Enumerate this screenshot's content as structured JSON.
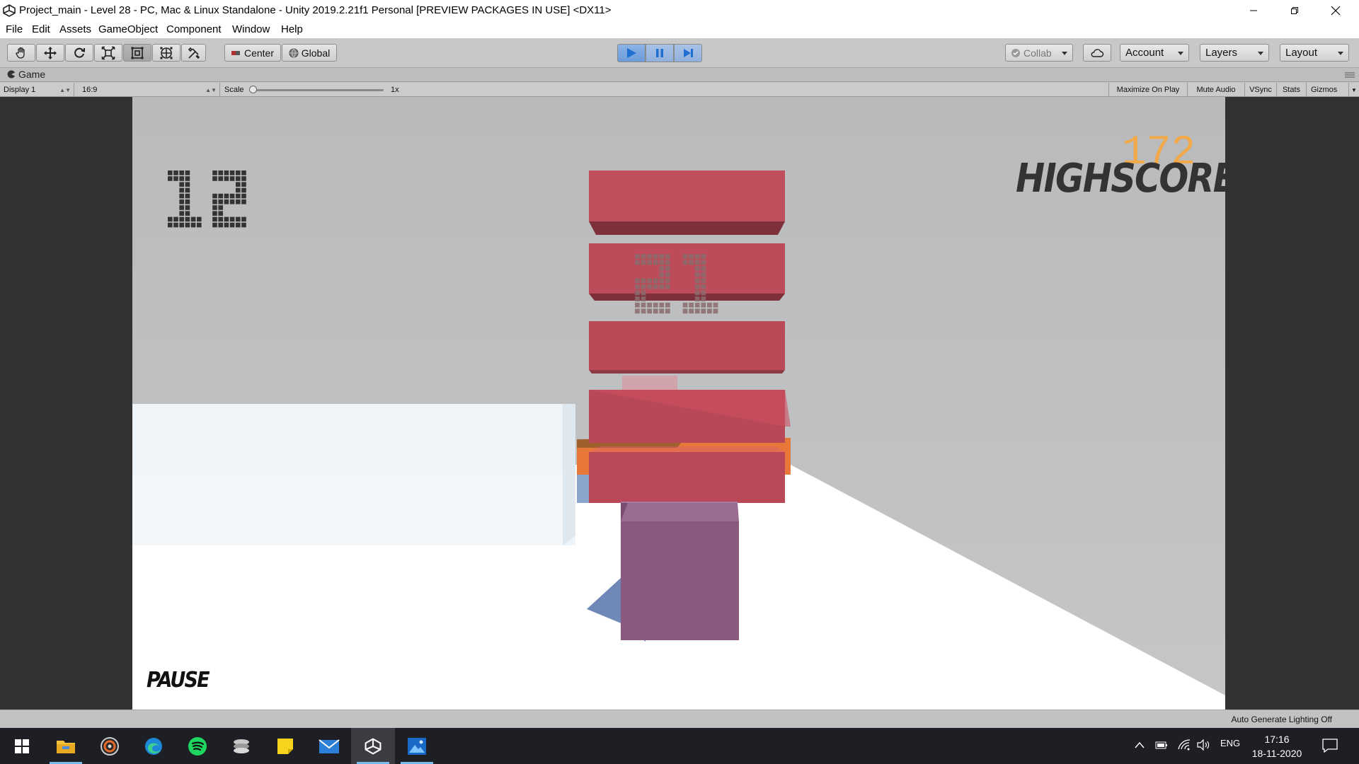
{
  "window": {
    "title": "Project_main - Level 28 - PC, Mac & Linux Standalone - Unity 2019.2.21f1 Personal [PREVIEW PACKAGES IN USE] <DX11>"
  },
  "menu": [
    "File",
    "Edit",
    "Assets",
    "GameObject",
    "Component",
    "Window",
    "Help"
  ],
  "toolbar": {
    "tools": [
      "hand-tool-icon",
      "move-tool-icon",
      "rotate-tool-icon",
      "scale-tool-icon",
      "rect-tool-icon",
      "transform-tool-icon",
      "custom-tool-icon"
    ],
    "pivot_label": "Center",
    "space_label": "Global",
    "collab_label": "Collab",
    "account_label": "Account",
    "layers_label": "Layers",
    "layout_label": "Layout",
    "play_state": "playing"
  },
  "game_view": {
    "tab_label": "Game",
    "display": "Display 1",
    "aspect": "16:9",
    "scale_label": "Scale",
    "scale_value": "1x",
    "scale_fraction": 0.0,
    "options": [
      "Maximize On Play",
      "Mute Audio",
      "VSync",
      "Stats",
      "Gizmos"
    ]
  },
  "game": {
    "level_number": "12",
    "center_number": "21",
    "highscore_value": "172",
    "highscore_label": "HIGHSCORE",
    "pause_label": "PAUSE",
    "colors": {
      "highscore_value": "#f2a94a",
      "slab": "#c04c5c",
      "player": "#8a5a7e",
      "orange_slab": "#e87a3c"
    }
  },
  "status": {
    "text": "Auto Generate Lighting Off"
  },
  "taskbar": {
    "apps": [
      "windows-start-icon",
      "file-explorer-icon",
      "media-player-icon",
      "edge-icon",
      "spotify-icon",
      "stack-app-icon",
      "sticky-notes-icon",
      "mail-icon",
      "unity-icon",
      "photos-icon"
    ],
    "language": "ENG",
    "time": "17:16",
    "date": "18-11-2020"
  }
}
